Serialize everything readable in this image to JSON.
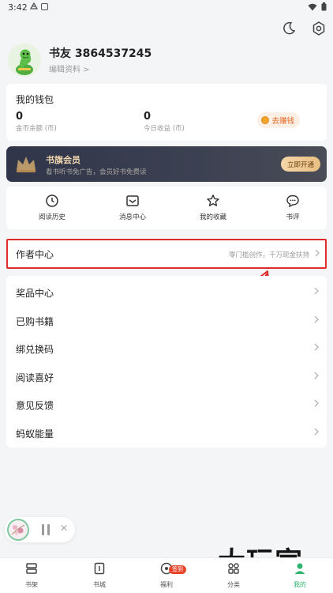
{
  "status_bar": {
    "time": "3:42"
  },
  "profile": {
    "username": "书友 3864537245",
    "edit_label": "编辑资料 >"
  },
  "wallet": {
    "title": "我的钱包",
    "coins_value": "0",
    "coins_label": "金币余额 (币)",
    "today_value": "0",
    "today_label": "今日收益 (币)",
    "earn_button": "去赚钱"
  },
  "vip": {
    "title": "书旗会员",
    "subtitle": "看书听书免广告，会员好书免费读",
    "button": "立即开通"
  },
  "quick_links": [
    {
      "label": "阅读历史",
      "icon": "clock-icon"
    },
    {
      "label": "消息中心",
      "icon": "message-icon"
    },
    {
      "label": "我的收藏",
      "icon": "star-icon"
    },
    {
      "label": "书评",
      "icon": "comment-icon"
    }
  ],
  "author_center": {
    "title": "作者中心",
    "description": "零门槛创作，千万现金扶持"
  },
  "menu_items": [
    "奖品中心",
    "已购书籍",
    "绑兑换码",
    "阅读喜好",
    "意见反馈",
    "蚂蚁能量"
  ],
  "tabs": [
    {
      "label": "书架",
      "icon": "bookshelf-icon"
    },
    {
      "label": "书城",
      "icon": "bookstore-icon"
    },
    {
      "label": "福利",
      "icon": "welfare-icon",
      "badge": "签到"
    },
    {
      "label": "分类",
      "icon": "category-icon"
    },
    {
      "label": "我的",
      "icon": "profile-icon",
      "active": true
    }
  ],
  "watermark": "大玩家",
  "colors": {
    "accent_green": "#2fb56d",
    "highlight_red": "#e02b2b",
    "earn_orange": "#e5651e",
    "vip_gold": "#f3d9b0"
  }
}
